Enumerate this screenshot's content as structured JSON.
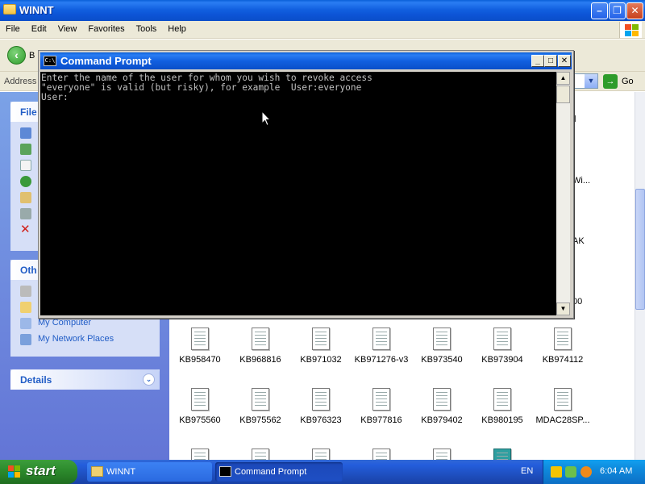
{
  "explorer": {
    "title": "WINNT",
    "menu": [
      "File",
      "Edit",
      "View",
      "Favorites",
      "Tools",
      "Help"
    ],
    "toolbar": {
      "back_label": "B"
    },
    "address": {
      "label": "Address",
      "go_label": "Go"
    },
    "taskpane": {
      "file_tasks_header": "File",
      "other_places_header": "Oth",
      "other_places": [
        "My Computer",
        "My Network Places"
      ],
      "details_header": "Details"
    },
    "files_row1": [
      "KB958470",
      "KB968816",
      "KB971032",
      "KB971276-v3",
      "KB973540",
      "KB973904",
      "KB974112"
    ],
    "files_row2": [
      "KB975560",
      "KB975562",
      "KB976323",
      "KB977816",
      "KB979402",
      "KB980195",
      "MDAC28SP..."
    ],
    "partial_right": [
      "l",
      "Wi...",
      "AK",
      "00"
    ]
  },
  "cmd": {
    "title": "Command Prompt",
    "icon_text": "C:\\",
    "lines": [
      "Enter the name of the user for whom you wish to revoke access",
      "\"everyone\" is valid (but risky), for example  User:everyone",
      "User:"
    ]
  },
  "taskbar": {
    "start_label": "start",
    "tasks": [
      "WINNT",
      "Command Prompt"
    ],
    "language": "EN",
    "clock": "6:04 AM"
  }
}
